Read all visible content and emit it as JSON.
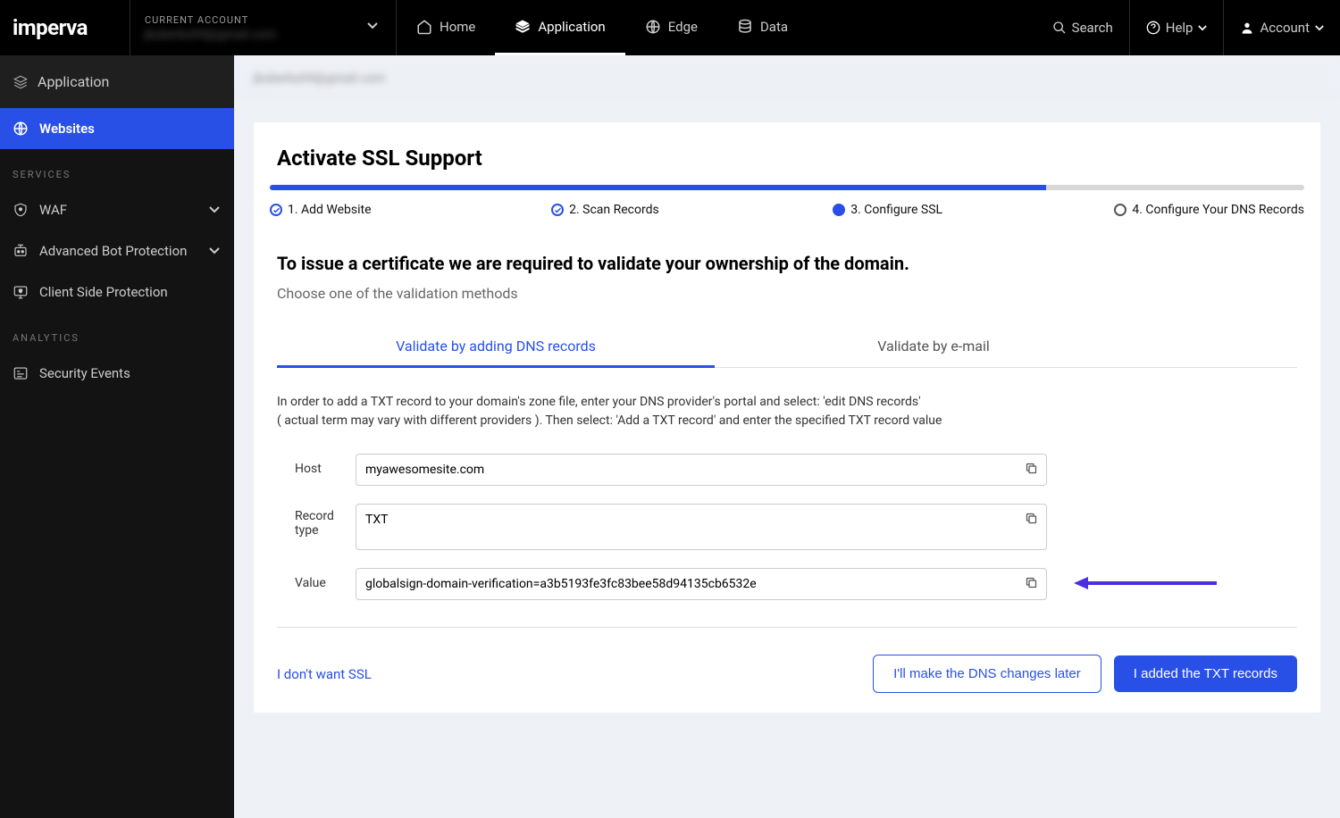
{
  "brand": "imperva",
  "account_switch": {
    "label": "CURRENT ACCOUNT",
    "value": "jkuberka94@gmail.com"
  },
  "topnav": {
    "home": "Home",
    "application": "Application",
    "edge": "Edge",
    "data": "Data"
  },
  "top_right": {
    "search": "Search",
    "help": "Help",
    "account": "Account"
  },
  "sidebar": {
    "head": "Application",
    "websites": "Websites",
    "section_services": "SERVICES",
    "waf": "WAF",
    "abp": "Advanced Bot Protection",
    "csp": "Client Side Protection",
    "section_analytics": "ANALYTICS",
    "sec_events": "Security Events"
  },
  "breadcrumb": "jkuberka94@gmail.com",
  "card": {
    "title": "Activate SSL Support",
    "progress_percent": 75,
    "steps": {
      "s1": "1. Add Website",
      "s2": "2. Scan Records",
      "s3": "3. Configure SSL",
      "s4": "4. Configure Your DNS Records"
    },
    "heading": "To issue a certificate we are required to validate your ownership of the domain.",
    "sub": "Choose one of the validation methods",
    "tabs": {
      "dns": "Validate by adding DNS records",
      "email": "Validate by e-mail"
    },
    "instructions_line1": "In order to add a TXT record to your domain's zone file, enter your DNS provider's portal and select: 'edit DNS records'",
    "instructions_line2": "( actual term may vary with different providers ). Then select: 'Add a TXT record' and enter the specified TXT record value",
    "fields": {
      "host_label": "Host",
      "host_value": "myawesomesite.com",
      "record_label": "Record type",
      "record_value": "TXT",
      "value_label": "Value",
      "value_value": "globalsign-domain-verification=a3b5193fe3fc83bee58d94135cb6532e"
    },
    "footer": {
      "nossl": "I don't want SSL",
      "later": "I'll make the DNS changes later",
      "added": "I added the TXT records"
    }
  }
}
